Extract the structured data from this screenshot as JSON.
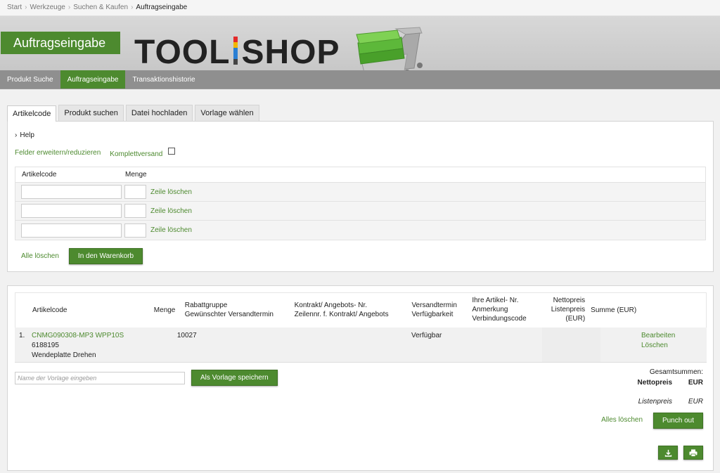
{
  "breadcrumb": {
    "items": [
      "Start",
      "Werkzeuge",
      "Suchen & Kaufen"
    ],
    "current": "Auftragseingabe",
    "separator": "›"
  },
  "header": {
    "page_title": "Auftragseingabe",
    "logo_left": "TOOL",
    "logo_right": "SHOP"
  },
  "nav": {
    "items": [
      {
        "label": "Produkt Suche",
        "active": false
      },
      {
        "label": "Auftragseingabe",
        "active": true
      },
      {
        "label": "Transaktionshistorie",
        "active": false
      }
    ]
  },
  "tabs": {
    "items": [
      {
        "label": "Artikelcode",
        "active": true
      },
      {
        "label": "Produkt suchen",
        "active": false
      },
      {
        "label": "Datei hochladen",
        "active": false
      },
      {
        "label": "Vorlage wählen",
        "active": false
      }
    ]
  },
  "entry": {
    "help_label": "Help",
    "expand_label": "Felder erweitern/reduzieren",
    "complete_label": "Komplettversand",
    "col_code": "Artikelcode",
    "col_qty": "Menge",
    "row_delete": "Zeile löschen",
    "clear_all": "Alle löschen",
    "add_to_cart": "In den Warenkorb"
  },
  "cart": {
    "headers": {
      "code": "Artikelcode",
      "qty": "Menge",
      "rabatt_1": "Rabattgruppe",
      "rabatt_2": "Gewünschter Versandtermin",
      "kontrakt_1": "Kontrakt/ Angebots- Nr.",
      "kontrakt_2": "Zeilennr. f. Kontrakt/ Angebots",
      "versand_1": "Versandtermin",
      "versand_2": "Verfügbarkeit",
      "ihre_1": "Ihre Artikel- Nr.",
      "ihre_2": "Anmerkung",
      "ihre_3": "Verbindungscode",
      "netto_1": "Nettopreis",
      "netto_2": "Listenpreis",
      "netto_3": "(EUR)",
      "summe": "Summe (EUR)"
    },
    "row": {
      "index": "1.",
      "code": "CNMG090308-MP3 WPP10S",
      "number": "6188195",
      "description": "Wendeplatte Drehen",
      "qty": "10",
      "rabatt": "027",
      "availability": "Verfügbar",
      "edit": "Bearbeiten",
      "delete": "Löschen"
    },
    "template_placeholder": "Name der Vorlage eingeben",
    "save_template": "Als Vorlage speichern",
    "totals_title": "Gesamtsummen:",
    "totals_net_label": "Nettopreis",
    "totals_net_currency": "EUR",
    "totals_list_label": "Listenpreis",
    "totals_list_currency": "EUR",
    "delete_all": "Alles löschen",
    "punch_out": "Punch out"
  },
  "colors": {
    "accent": "#4d8a2f",
    "header_bg": "#c8c8c8"
  }
}
